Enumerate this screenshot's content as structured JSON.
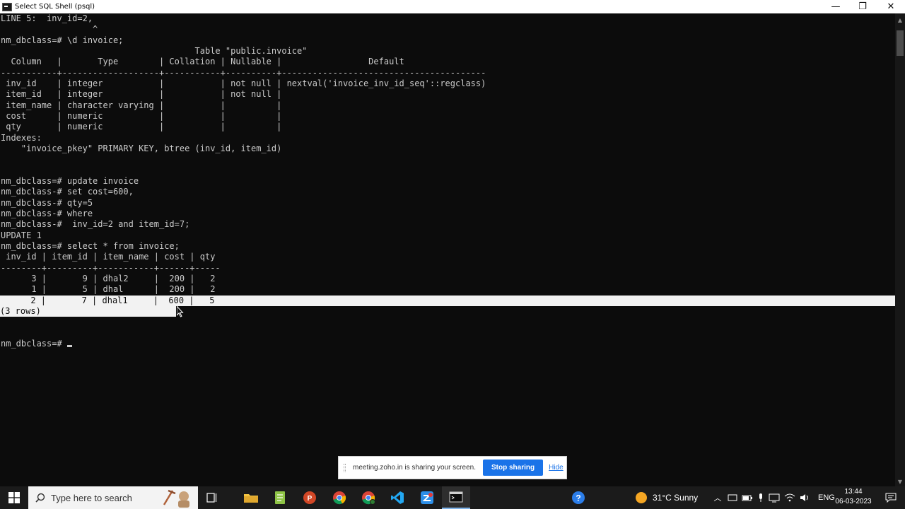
{
  "window": {
    "title": "Select SQL Shell (psql)",
    "minimize_glyph": "—",
    "maximize_glyph": "❐",
    "close_glyph": "✕"
  },
  "terminal": {
    "lines": [
      "LINE 5:  inv_id=2,",
      "                  ^",
      "nm_dbclass=# \\d invoice;",
      "                                      Table \"public.invoice\"",
      "  Column   |       Type        | Collation | Nullable |                 Default",
      "-----------+-------------------+-----------+----------+----------------------------------------",
      " inv_id    | integer           |           | not null | nextval('invoice_inv_id_seq'::regclass)",
      " item_id   | integer           |           | not null |",
      " item_name | character varying |           |          |",
      " cost      | numeric           |           |          |",
      " qty       | numeric           |           |          |",
      "Indexes:",
      "    \"invoice_pkey\" PRIMARY KEY, btree (inv_id, item_id)",
      "",
      "",
      "nm_dbclass=# update invoice",
      "nm_dbclass-# set cost=600,",
      "nm_dbclass-# qty=5",
      "nm_dbclass-# where",
      "nm_dbclass-#  inv_id=2 and item_id=7;",
      "UPDATE 1",
      "nm_dbclass=# select * from invoice;",
      " inv_id | item_id | item_name | cost | qty",
      "--------+---------+-----------+------+-----",
      "      3 |       9 | dhal2     |  200 |   2",
      "      1 |       5 | dhal      |  200 |   2",
      "      2 |       7 | dhal1     |  600 |   5",
      "(3 rows)",
      "",
      "",
      "nm_dbclass=# "
    ]
  },
  "sharing_bar": {
    "message": "meeting.zoho.in is sharing your screen.",
    "stop_label": "Stop sharing",
    "hide_label": "Hide"
  },
  "taskbar": {
    "search_placeholder": "Type here to search",
    "weather_text": "31°C  Sunny",
    "language": "ENG",
    "time": "13:44",
    "date": "06-03-2023"
  }
}
